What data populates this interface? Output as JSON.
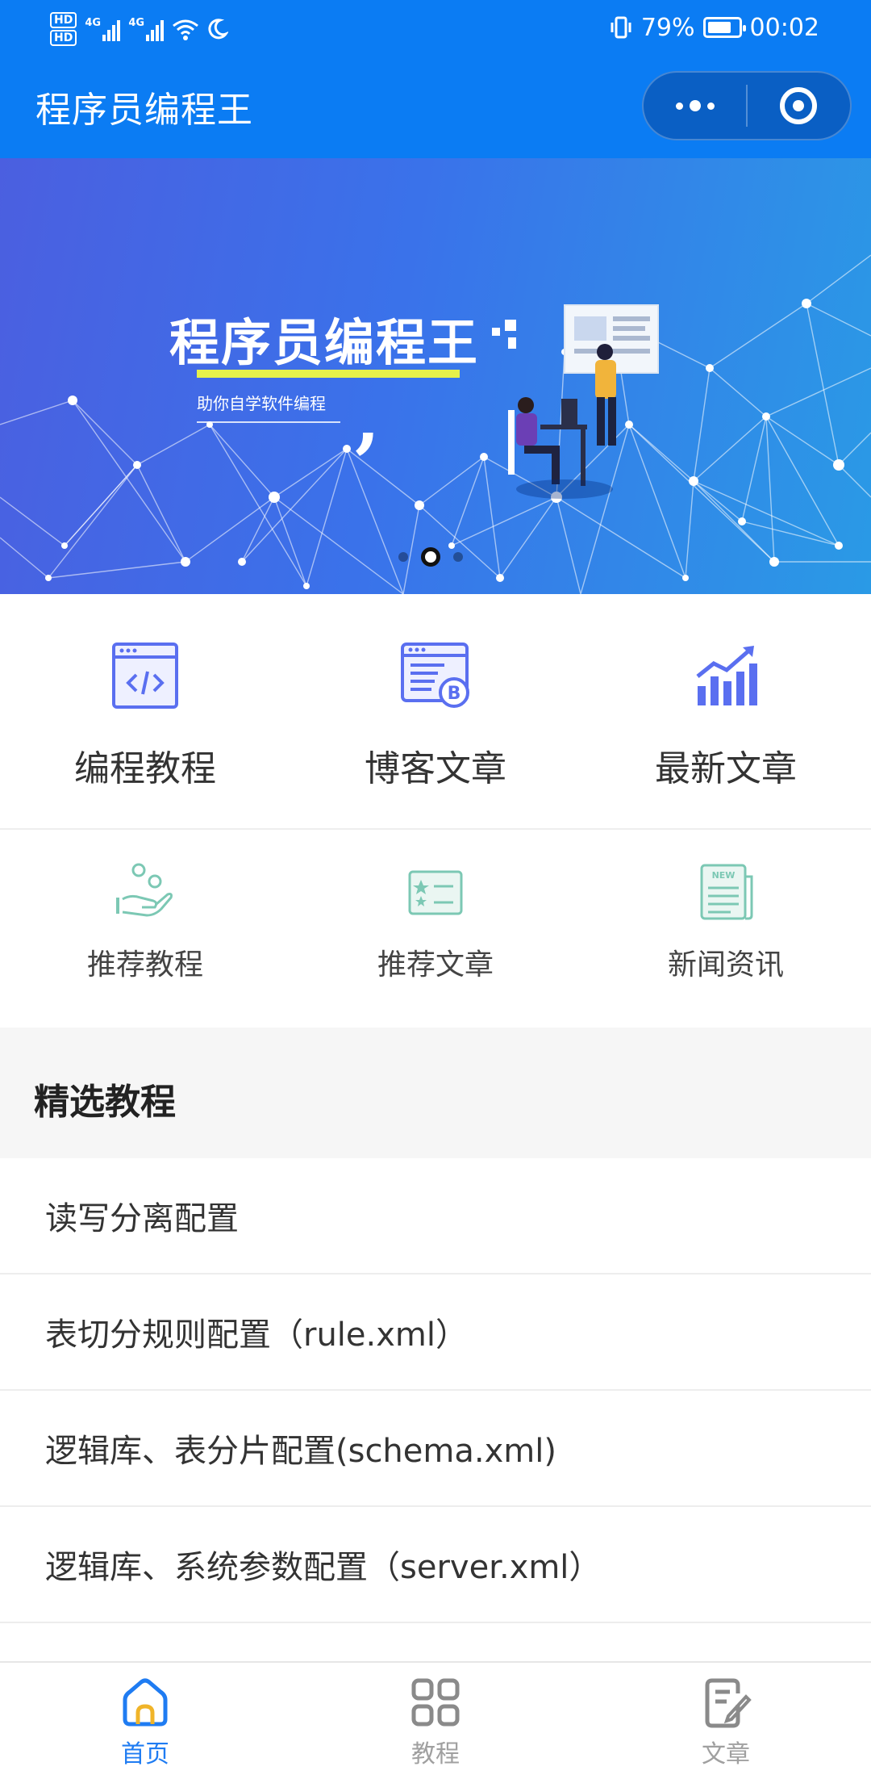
{
  "status_bar": {
    "battery": "79%",
    "time": "00:02",
    "hd1": "HD",
    "hd2": "HD",
    "net1": "4G",
    "net2": "4G"
  },
  "header": {
    "title": "程序员编程王"
  },
  "banner": {
    "title": "程序员编程王",
    "subtitle": "助你自学软件编程",
    "active_slide": 2,
    "slide_count": 3
  },
  "grid_main": [
    {
      "label": "编程教程",
      "icon": "code-window-icon"
    },
    {
      "label": "博客文章",
      "icon": "blog-browser-icon"
    },
    {
      "label": "最新文章",
      "icon": "bar-chart-trend-icon"
    }
  ],
  "grid_secondary": [
    {
      "label": "推荐教程",
      "icon": "hand-coins-icon"
    },
    {
      "label": "推荐文章",
      "icon": "star-card-icon"
    },
    {
      "label": "新闻资讯",
      "icon": "newspaper-icon"
    }
  ],
  "section": {
    "title": "精选教程"
  },
  "list": [
    "读写分离配置",
    "表切分规则配置（rule.xml）",
    "逻辑库、表分片配置(schema.xml)",
    "逻辑库、系统参数配置（server.xml）"
  ],
  "tabbar": [
    {
      "label": "首页",
      "icon": "home-icon",
      "active": true
    },
    {
      "label": "教程",
      "icon": "grid-icon",
      "active": false
    },
    {
      "label": "文章",
      "icon": "document-edit-icon",
      "active": false
    }
  ],
  "colors": {
    "primary": "#0b7cf3",
    "tab_active": "#1f7cf2",
    "icon_blue": "#5a6ff0",
    "icon_green": "#7cc8b4"
  }
}
